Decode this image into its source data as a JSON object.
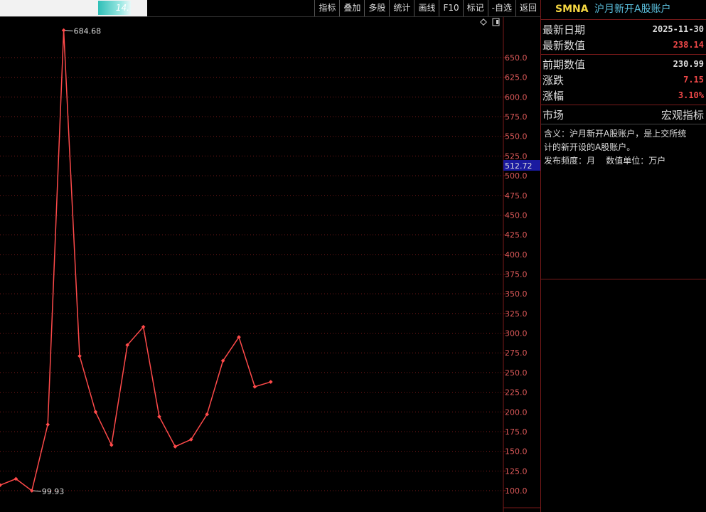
{
  "toolbar": {
    "tab_value": "14.",
    "buttons": [
      "指标",
      "叠加",
      "多股",
      "统计",
      "画线",
      "F10",
      "标记",
      "-自选",
      "返回"
    ]
  },
  "panel": {
    "code": "SMNA",
    "name": "沪月新开A股账户",
    "latest_date_label": "最新日期",
    "latest_date": "2025-11-30",
    "latest_value_label": "最新数值",
    "latest_value": "238.14",
    "prev_value_label": "前期数值",
    "prev_value": "230.99",
    "change_label": "涨跌",
    "change": "7.15",
    "change_pct_label": "涨幅",
    "change_pct": "3.10%",
    "market_label": "市场",
    "market_value": "宏观指标",
    "desc_line1": "含义：沪月新开A股账户，是上交所统",
    "desc_line2": "计的新开设的A股账户。",
    "desc_line3": "发布频度：月    数值单位：万户"
  },
  "chart_data": {
    "type": "line",
    "ylim": [
      85,
      710
    ],
    "yticks": [
      100.0,
      125.0,
      150.0,
      175.0,
      200.0,
      225.0,
      250.0,
      275.0,
      300.0,
      325.0,
      350.0,
      375.0,
      400.0,
      425.0,
      450.0,
      475.0,
      500.0,
      525.0,
      550.0,
      575.0,
      600.0,
      625.0,
      650.0
    ],
    "ytick_labels": [
      "100.0",
      "125.0",
      "150.0",
      "175.0",
      "200.0",
      "225.0",
      "250.0",
      "275.0",
      "300.0",
      "325.0",
      "350.0",
      "375.0",
      "400.0",
      "425.0",
      "450.0",
      "475.0",
      "500.0",
      "525.0",
      "550.0",
      "575.0",
      "600.0",
      "625.0",
      "650.0"
    ],
    "values": [
      107,
      115,
      99.93,
      184,
      684.68,
      271,
      200,
      158,
      285,
      308,
      194,
      156,
      165,
      197,
      265,
      295,
      232,
      238.14
    ],
    "max_label": "684.68",
    "min_label": "99.93",
    "cursor_value": "512.72",
    "line_color": "#ff4a4a",
    "grid_color": "#7a1a1a",
    "cursor_bg": "#1a1aa0"
  }
}
